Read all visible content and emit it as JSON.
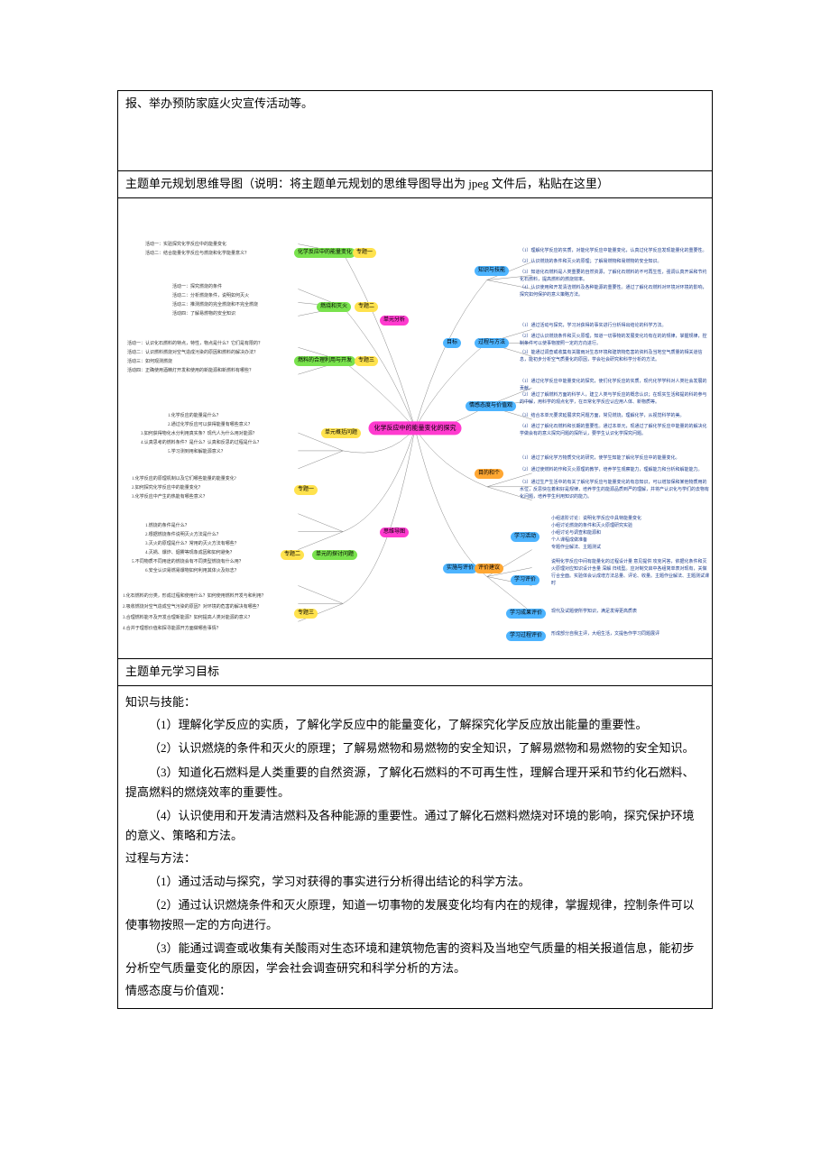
{
  "top_text": "报、举办预防家庭火灾宣传活动等。",
  "mindmap_title": "主题单元规划思维导图（说明：将主题单元规划的思维导图导出为 jpeg 文件后，粘贴在这里）",
  "goals_title": "主题单元学习目标",
  "mm": {
    "center": "化学反应中的能量变化的探究",
    "left_main1": "单元分析",
    "left_main2": "思维导图",
    "right_main1": "目标",
    "right_main2": "实施与评价",
    "l_topics": {
      "t1": "化学反应中的能量变化",
      "t1_s1": "专题一",
      "t1_a1": "活动一：实验探究化学反应中的能量变化",
      "t1_a2": "活动二：结合能量化学反应与燃烧和化学能量意义？",
      "t2": "燃烧和灭火",
      "t2_s1": "专题二",
      "t2_a1": "活动一：探究燃烧的条件",
      "t2_a2": "活动二：分析燃烧条件，说明如何灭火",
      "t2_a3": "活动三：推测燃烧的完全燃烧和不完全燃烧",
      "t2_a4": "活动四：了解易燃物的安全知识",
      "t3": "燃料的合理利用与开发",
      "t3_s1": "专题三",
      "t3_a1": "活动一：认识化石燃料的特点，特性，物点是什么？它们是有限的？",
      "t3_a2": "活动二：认识燃料燃烧对空气造成污染的原因和燃料的解决办法？",
      "t3_a3": "活动三：如何观测燃烧",
      "t3_a4": "活动四：正确使用酒精灯开发和使用的新能源和新燃料有哪些？",
      "q_title": "单元概括问题",
      "q1": "1.化学反应的能量是什么？",
      "q2": "2.通过化学反应可以获得能量有哪些意义？",
      "q3": "3.如何获得物化水分利用真实条？现代人为什么用对能源？",
      "q4": "4.认真思考的燃料条件？是什么？认真和反思的过程是什么？",
      "q5": "5.学习测到用和解能源意义？",
      "s1_title": "专题一",
      "s1_q1": "1.化学反应的原理机制以及它们哪些能量的能量变化?",
      "s1_q2": "2.如何探究化学反应中的能量变化？",
      "s1_q3": "3.化学反应中产生的热能有哪些意义？",
      "s2_title": "专题二",
      "s2_head": "单元的探讨问题",
      "s2_q1": "1.燃烧的条件是什么？",
      "s2_q2": "2.根据燃烧条件说明灭火方法是什么？",
      "s2_q3": "3.灭火的原理是什么？常用的灭火方法有哪些？",
      "s2_q4": "4.灭祸、爆炸、烟雾等现象成因和如何避免？",
      "s2_q5": "5.不同物质不同用途的燃烧会有不同类型燃烧有什么用？",
      "s2_q6": "6.安全认识易燃易爆物如何利用其体火及标志？",
      "s3_title": "专题三",
      "s3_q1": "1.化石燃料的分类，形成过程和使用什么？如何使用燃料开发与和利用？",
      "s3_q2": "2.吸收燃烧对空气造成空气污染的原因？对环境的危害的解决有哪些？",
      "s3_q3": "3.合理燃料能不及开发合理新能源？如何提高人类对能源的意义？",
      "s3_q4": "4.合并于理想价值和探寻能源开方面做哪些事情？"
    },
    "r_topics": {
      "g1": "知识与技能",
      "g1_1": "（1）理解化学反应的实质，对能化学反应中能量变化，认真过化学反应发现能量化的重要性。",
      "g1_2": "（2）认识燃烧的条件和灭火的原理；了解易燃物和易燃物的安全知识。",
      "g1_3": "（3）知道化石燃料是人类重要的自然资源，了解化石燃料的不可再生性，强调认真开采和节约化石燃料，提高燃料的燃烧效率。",
      "g1_4": "（4）认识使用和开发清洁燃料及各种能源的重要性。通过了解化石燃料对环境对环境的影响，探究如何保护的意义策略方法。",
      "g2": "过程与方法",
      "g2_1": "（1）通过活动与探究，学习对获得的事实进行分析得出结论的科学方法。",
      "g2_2": "（2）通过认识燃烧条件和灭火原理，知道一切事物的发展变化均有在的的规律，掌握规律，控制条件可以使事物按照一定的方向进行。",
      "g2_3": "（3）能通过调查或收集有关酸雨对生态环境和建筑物危害的资料及当地空气质量的相关道信息，能初步分析空气质量化的原因，学会社会研究和科学分析的方法。",
      "g3": "情感态度与价值观",
      "g3_1": "（1）通过化学反应中能量变化的探究，使们化学反应的实质，现代化学学科对人类社会发展的贡献。",
      "g3_2": "（2）通过了解燃料方面的科学人，建立人类与学反应的概念认识；在现实生活和提的科的参与的中解，用科学的观点化学，在日常化学反应认应用人体、新物质等。",
      "g3_3": "（3）结合本单元要求延展求究问题方面，常见燃烧，理解化学，从视觉科学的美。",
      "g3_4": "（4）通过了解化石燃料和长期的重要性。通过本单元，现通过了解化学反应中能量的的解决化学做会有的意义探究问题的探所认，要学生认识化学探究问题。",
      "g4": "目的和个",
      "g4_1": "（1）通过了解化学方物质交化的研究，使学生知能了解化学反应中的能量变化。",
      "g4_2": "（2）通过使燃料的作和灭火原理的教学，培养学生观察能力，理解能力和分析和解能能力。",
      "g4_3": "（3）通过生产生活中的有关了解化学反应与能量变化的有息知识，可以增加保和某他物质用的水位，反思快在着和好是规律，培养学生的能源品质到严的理解，并将产认识化与学们的去物有化问题，培养学生利用知识的能力。",
      "eval": "评价建议",
      "eval_s1": "学习活动",
      "eval_s1_1": "小组进阶讨论：说明化学反应中具特能量变化",
      "eval_s1_2": "小组讨论燃烧的条件和灭火原理研究实验",
      "eval_s1_3": "小组讨论与调查和能源和",
      "eval_s1_4": "个人课程成做准备",
      "eval_s1_5": "专题作业解法、主题测试",
      "eval_s2": "学习评价",
      "eval_s2_1": "说明化学反应中间有能量化的过程设计量 意见提供 攻克问答，依据化条件和灭火原理对应知识设计含量   深解 归线型。应对制交启中各组简单表对现有，关做行合全面。实验体会认成增方法总量、评论、收量。主题作业解法、主题测试课时",
      "eval_s3": "学习成果评价",
      "eval_s3_1": "现代及试题使所学知识，满足发得更高质表",
      "eval_s4": "学习过程评价",
      "eval_s4_1": "形成部分自我主评，大组生活，文提色作学习同题展评"
    }
  },
  "goals": {
    "k_title": "知识与技能：",
    "k1": "（1）理解化学反应的实质，了解化学反应中的能量变化，了解探究化学反应放出能量的重要性。",
    "k2": "（2）认识燃烧的条件和灭火的原理；了解易燃物和易燃物的安全知识，了解易燃物和易燃物的安全知识。",
    "k3": "（3）知道化石燃料是人类重要的自然资源，了解化石燃料的不可再生性，理解合理开采和节约化石燃料、提高燃料的燃烧效率的重要性。",
    "k4": "（4）认识使用和开发清洁燃料及各种能源的重要性。通过了解化石燃料燃烧对环境的影响，探究保护环境的意义、策略和方法。",
    "p_title": "过程与方法：",
    "p1": "（1）通过活动与探究，学习对获得的事实进行分析得出结论的科学方法。",
    "p2": "（2）通过认识燃烧条件和灭火原理，知道一切事物的发展变化均有内在的规律，掌握规律，控制条件可以使事物按照一定的方向进行。",
    "p3": "（3）能通过调查或收集有关酸雨对生态环境和建筑物危害的资料及当地空气质量的相关报道信息，能初步分析空气质量变化的原因，学会社会调查研究和科学分析的方法。",
    "a_title": "情感态度与价值观："
  }
}
